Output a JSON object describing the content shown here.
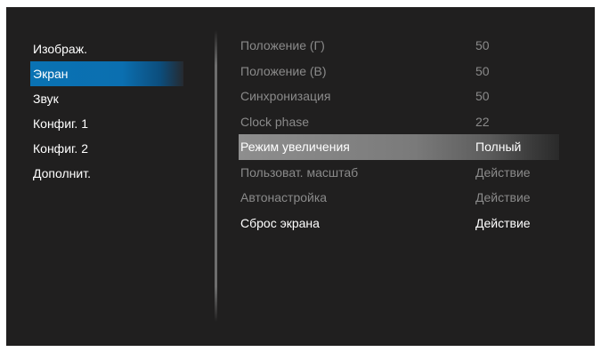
{
  "left_menu": {
    "items": [
      {
        "label": "Изображ."
      },
      {
        "label": "Экран"
      },
      {
        "label": "Звук"
      },
      {
        "label": "Конфиг. 1"
      },
      {
        "label": "Конфиг. 2"
      },
      {
        "label": "Дополнит."
      }
    ],
    "active_index": 1
  },
  "settings": {
    "rows": [
      {
        "label": "Положение (Г)",
        "value": "50",
        "state": "disabled"
      },
      {
        "label": "Положение (В)",
        "value": "50",
        "state": "disabled"
      },
      {
        "label": "Синхронизация",
        "value": "50",
        "state": "disabled"
      },
      {
        "label": "Clock phase",
        "value": "22",
        "state": "disabled"
      },
      {
        "label": "Режим увеличения",
        "value": "Полный",
        "state": "selected"
      },
      {
        "label": "Пользоват. масштаб",
        "value": "Действие",
        "state": "disabled"
      },
      {
        "label": "Автонастройка",
        "value": "Действие",
        "state": "disabled"
      },
      {
        "label": "Сброс экрана",
        "value": "Действие",
        "state": "enabled"
      }
    ]
  },
  "colors": {
    "background": "#201f1f",
    "accent": "#0a72b3",
    "disabled_text": "#8a8a8a",
    "text": "#ffffff"
  }
}
